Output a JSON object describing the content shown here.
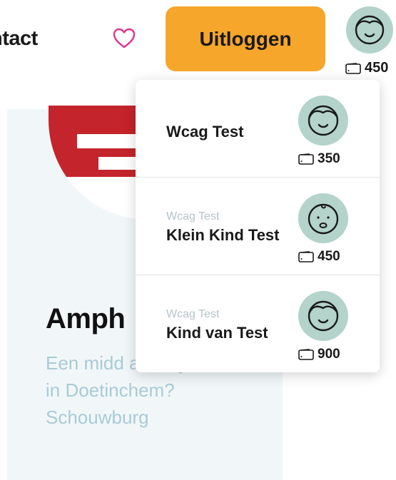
{
  "header": {
    "nav_contact": "ntact",
    "logout_label": "Uitloggen",
    "credits": "450",
    "accent_color": "#f6a62b",
    "heart_color": "#e0338f",
    "icons": [
      "heart-icon",
      "avatar-boy-icon",
      "wallet-icon"
    ]
  },
  "card": {
    "title": "Amph",
    "description": "Een midd avondje uit in Doetinchem? Schouwburg",
    "background": "#f1f7f9"
  },
  "dropdown": {
    "profiles": [
      {
        "parent": "",
        "name": "Wcag Test",
        "credits": "350",
        "avatar": "boy-face-icon"
      },
      {
        "parent": "Wcag Test",
        "name": "Klein Kind Test",
        "credits": "450",
        "avatar": "baby-face-icon"
      },
      {
        "parent": "Wcag Test",
        "name": "Kind van Test",
        "credits": "900",
        "avatar": "boy-face-icon"
      }
    ],
    "avatar_bg": "#b3d3cb"
  }
}
